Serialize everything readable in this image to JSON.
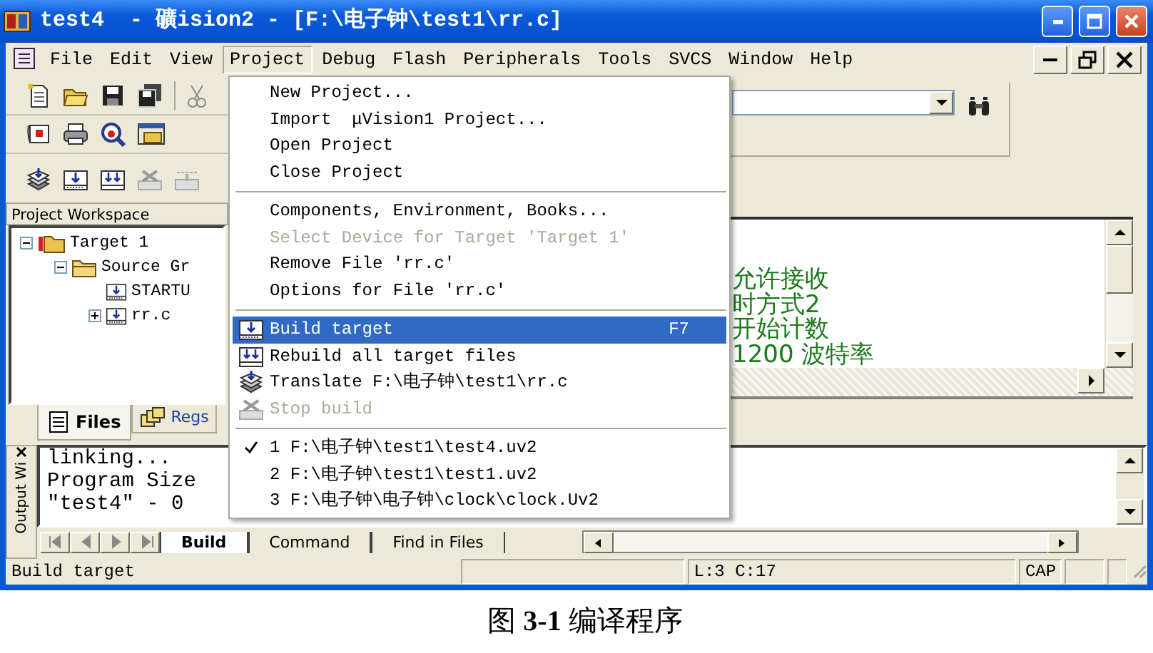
{
  "window": {
    "title": "test4  - 礦ision2 - [F:\\电子钟\\test1\\rr.c]"
  },
  "menu_bar": [
    {
      "label": "File",
      "selected": false
    },
    {
      "label": "Edit",
      "selected": false
    },
    {
      "label": "View",
      "selected": false
    },
    {
      "label": "Project",
      "selected": true
    },
    {
      "label": "Debug",
      "selected": false
    },
    {
      "label": "Flash",
      "selected": false
    },
    {
      "label": "Peripherals",
      "selected": false
    },
    {
      "label": "Tools",
      "selected": false
    },
    {
      "label": "SVCS",
      "selected": false
    },
    {
      "label": "Window",
      "selected": false
    },
    {
      "label": "Help",
      "selected": false
    }
  ],
  "project_menu": {
    "sections": [
      [
        {
          "label": "New Project...",
          "selected": false,
          "disabled": false,
          "checked": false
        },
        {
          "label": "Import  μVision1 Project...",
          "selected": false,
          "disabled": false,
          "checked": false
        },
        {
          "label": "Open Project",
          "selected": false,
          "disabled": false,
          "checked": false
        },
        {
          "label": "Close Project",
          "selected": false,
          "disabled": false,
          "checked": false
        }
      ],
      [
        {
          "label": "Components, Environment, Books...",
          "selected": false,
          "disabled": false,
          "checked": false
        },
        {
          "label": "Select Device for Target 'Target 1'",
          "selected": false,
          "disabled": true,
          "checked": false
        },
        {
          "label": "Remove File 'rr.c'",
          "selected": false,
          "disabled": false,
          "checked": false
        },
        {
          "label": "Options for File 'rr.c'",
          "selected": false,
          "disabled": false,
          "checked": false
        }
      ],
      [
        {
          "label": "Build target",
          "shortcut": "F7",
          "selected": true,
          "disabled": false,
          "checked": false
        },
        {
          "label": "Rebuild all target files",
          "selected": false,
          "disabled": false,
          "checked": false
        },
        {
          "label": "Translate F:\\电子钟\\test1\\rr.c",
          "selected": false,
          "disabled": false,
          "checked": false
        },
        {
          "label": "Stop build",
          "selected": false,
          "disabled": true,
          "checked": false
        }
      ],
      [
        {
          "label": "1 F:\\电子钟\\test1\\test4.uv2",
          "selected": false,
          "disabled": false,
          "checked": true
        },
        {
          "label": "2 F:\\电子钟\\test1\\test1.uv2",
          "selected": false,
          "disabled": false,
          "checked": false
        },
        {
          "label": "3 F:\\电子钟\\电子钟\\clock\\clock.Uv2",
          "selected": false,
          "disabled": false,
          "checked": false
        }
      ]
    ]
  },
  "workspace": {
    "title": "Project Workspace",
    "tree": [
      {
        "label": "Target 1",
        "expanded": true,
        "children": [
          {
            "label": "Source Gr",
            "expanded": true,
            "children": [
              {
                "label": "STARTU"
              },
              {
                "label": "rr.c",
                "expanded": false
              }
            ]
          }
        ]
      }
    ],
    "tabs": [
      {
        "label": "Files",
        "selected": true
      },
      {
        "label": "Regs",
        "selected": false
      }
    ]
  },
  "editor": {
    "lines": [
      "允许接收",
      "时方式2",
      "开始计数",
      "1200 波特率"
    ]
  },
  "output": {
    "title": "Output Wi",
    "lines": [
      "linking...",
      "Program Size",
      "\"test4\" - 0"
    ],
    "tabs": [
      {
        "label": "Build",
        "selected": true
      },
      {
        "label": "Command",
        "selected": false
      },
      {
        "label": "Find in Files",
        "selected": false
      }
    ]
  },
  "status_bar": {
    "message": "Build target",
    "position": "L:3 C:17",
    "caps": "CAP"
  },
  "caption": "图 **3-1** 编译程序"
}
